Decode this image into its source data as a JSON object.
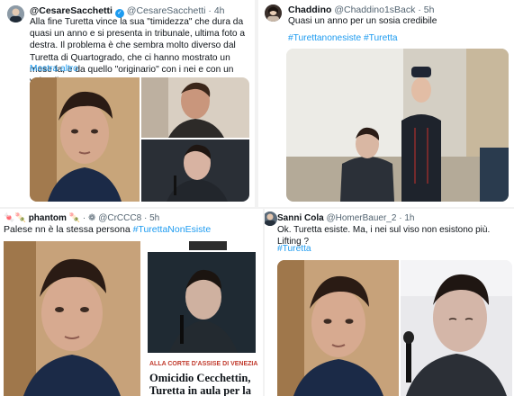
{
  "tweets": [
    {
      "display_name": "@CesareSacchetti",
      "handle": "@CesareSacchetti",
      "time": "4h",
      "text": "Alla fine Turetta vince la sua \"timidezza\" che dura da quasi un anno e si presenta in tribunale, ultima foto a destra. Il problema è che sembra molto diverso dal Turetta di Quartogrado, che ci hanno mostrato un mese fa, e da quello \"originario\" con i nei e con un volto diverso",
      "show_more": "Mostra altro"
    },
    {
      "display_name": "Chaddino",
      "handle": "@Chaddino1sBack",
      "time": "5h",
      "text": "Quasi un anno per un sosia credibile",
      "hashtags": "#Turettanonesiste #Turetta"
    },
    {
      "display_name": "phantom",
      "handle": "@CrCCC8",
      "time": "5h",
      "text_plain": "Palese nn è la stessa persona ",
      "hashtag": "#TurettaNonEsiste",
      "news_caption": "ALLA CORTE D'ASSISE DI VENEZIA",
      "news_headline_1": "Omicidio Cecchettin,",
      "news_headline_2": "Turetta in aula per la"
    },
    {
      "display_name": "Sanni Cola",
      "handle": "@HomerBauer_2",
      "time": "1h",
      "text": "Ok. Turetta esiste. Ma, i nei sul viso non esistono più. Lifting ?",
      "hashtag": "#Turetta"
    }
  ],
  "icons": [
    "verified-badge-icon",
    "avatar-icon"
  ],
  "colors": {
    "link": "#1d9bf0",
    "text": "#0f1419",
    "meta": "#536471",
    "news_caption": "#c0392b"
  }
}
